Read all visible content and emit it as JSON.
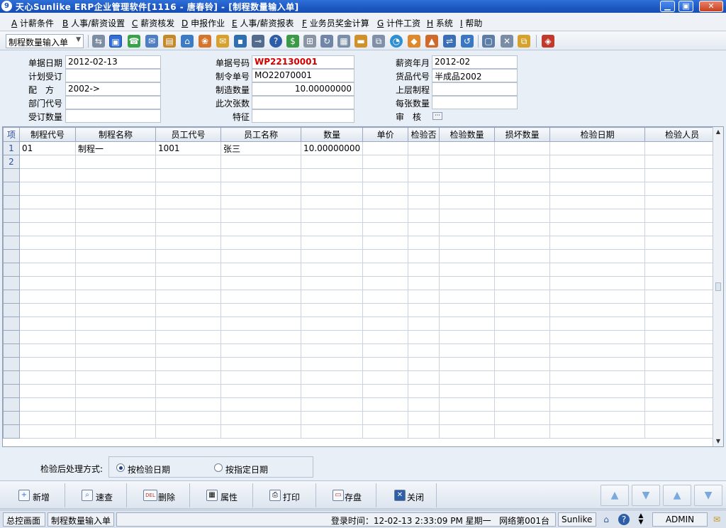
{
  "window": {
    "app_icon": "9",
    "title": "天心Sunlike ERP企业管理软件[1116 - 唐春铃] - [制程数量输入单]",
    "minimize": "▁",
    "restore": "▣",
    "close": "✕"
  },
  "menu": [
    {
      "key": "A",
      "label": "计薪条件"
    },
    {
      "key": "B",
      "label": "人事/薪资设置"
    },
    {
      "key": "C",
      "label": "薪资核发"
    },
    {
      "key": "D",
      "label": "申报作业"
    },
    {
      "key": "E",
      "label": "人事/薪资报表"
    },
    {
      "key": "F",
      "label": "业务员奖金计算"
    },
    {
      "key": "G",
      "label": "计件工资"
    },
    {
      "key": "H",
      "label": "系统"
    },
    {
      "key": "I",
      "label": "帮助"
    }
  ],
  "toolbar": {
    "doc_type": "制程数量输入单",
    "icons": [
      "⇆",
      "▣",
      "☎",
      "✉",
      "▤",
      "⌂",
      "❀",
      "✉",
      "▪",
      "⊸",
      "?",
      "$",
      "⊞",
      "↻",
      "▦",
      "▬",
      "⧉",
      "◔",
      "◆",
      "▲",
      "⇌",
      "↺",
      "▢",
      "✕",
      "⧉",
      "◈"
    ]
  },
  "form": {
    "doc_date_label": "单据日期",
    "doc_date": "2012-02-13",
    "plan_order_label": "计划受订",
    "plan_order": "",
    "recipe_label": "配　方",
    "recipe": "2002->",
    "dept_label": "部门代号",
    "dept": "",
    "order_qty_label": "受订数量",
    "order_qty": "",
    "doc_no_label": "单据号码",
    "doc_no": "WP22130001",
    "mo_no_label": "制令单号",
    "mo_no": "MO22070001",
    "mfg_qty_label": "制造数量",
    "mfg_qty": "10.00000000",
    "sheets_label": "此次张数",
    "sheets": "",
    "feature_label": "特征",
    "feature": "",
    "pay_month_label": "薪资年月",
    "pay_month": "2012-02",
    "item_no_label": "货品代号",
    "item_no": "半成品2002",
    "upper_proc_label": "上层制程",
    "upper_proc": "",
    "per_sheet_label": "每张数量",
    "per_sheet": "",
    "review_label": "审　核",
    "review_btn": "···"
  },
  "grid": {
    "columns": [
      "项",
      "制程代号",
      "制程名称",
      "员工代号",
      "员工名称",
      "数量",
      "单价",
      "检验否",
      "检验数量",
      "损坏数量",
      "检验日期",
      "检验人员"
    ],
    "rows": [
      [
        "1",
        "01",
        "制程一",
        "1001",
        "张三",
        "10.00000000",
        "",
        "",
        "",
        "",
        "",
        ""
      ],
      [
        "2",
        "",
        "",
        "",
        "",
        "",
        "",
        "",
        "",
        "",
        "",
        ""
      ]
    ],
    "scroll_up": "▲",
    "scroll_down": "▼"
  },
  "post_process": {
    "label": "检验后处理方式:",
    "option1": "按检验日期",
    "option2": "按指定日期",
    "selected": "option1"
  },
  "actions": {
    "add": "新增",
    "add_icon": "+",
    "query": "速查",
    "query_icon": "⌕",
    "delete": "删除",
    "delete_icon": "DEL",
    "props": "属性",
    "props_icon": "▦",
    "print": "打印",
    "print_icon": "⎙",
    "save": "存盘",
    "save_icon": "▭",
    "close": "关闭",
    "close_icon": "✕",
    "first": "▲",
    "prev": "▼",
    "next": "▲",
    "last": "▼"
  },
  "status": {
    "main_screen": "总控画面",
    "current_doc": "制程数量输入单",
    "login_time": "登录时间：12-02-13 2:33:09 PM  星期一",
    "network": "网络第001台",
    "product": "Sunlike E",
    "help_icon": "?",
    "user": "ADMIN",
    "mail_icon": "✉"
  }
}
